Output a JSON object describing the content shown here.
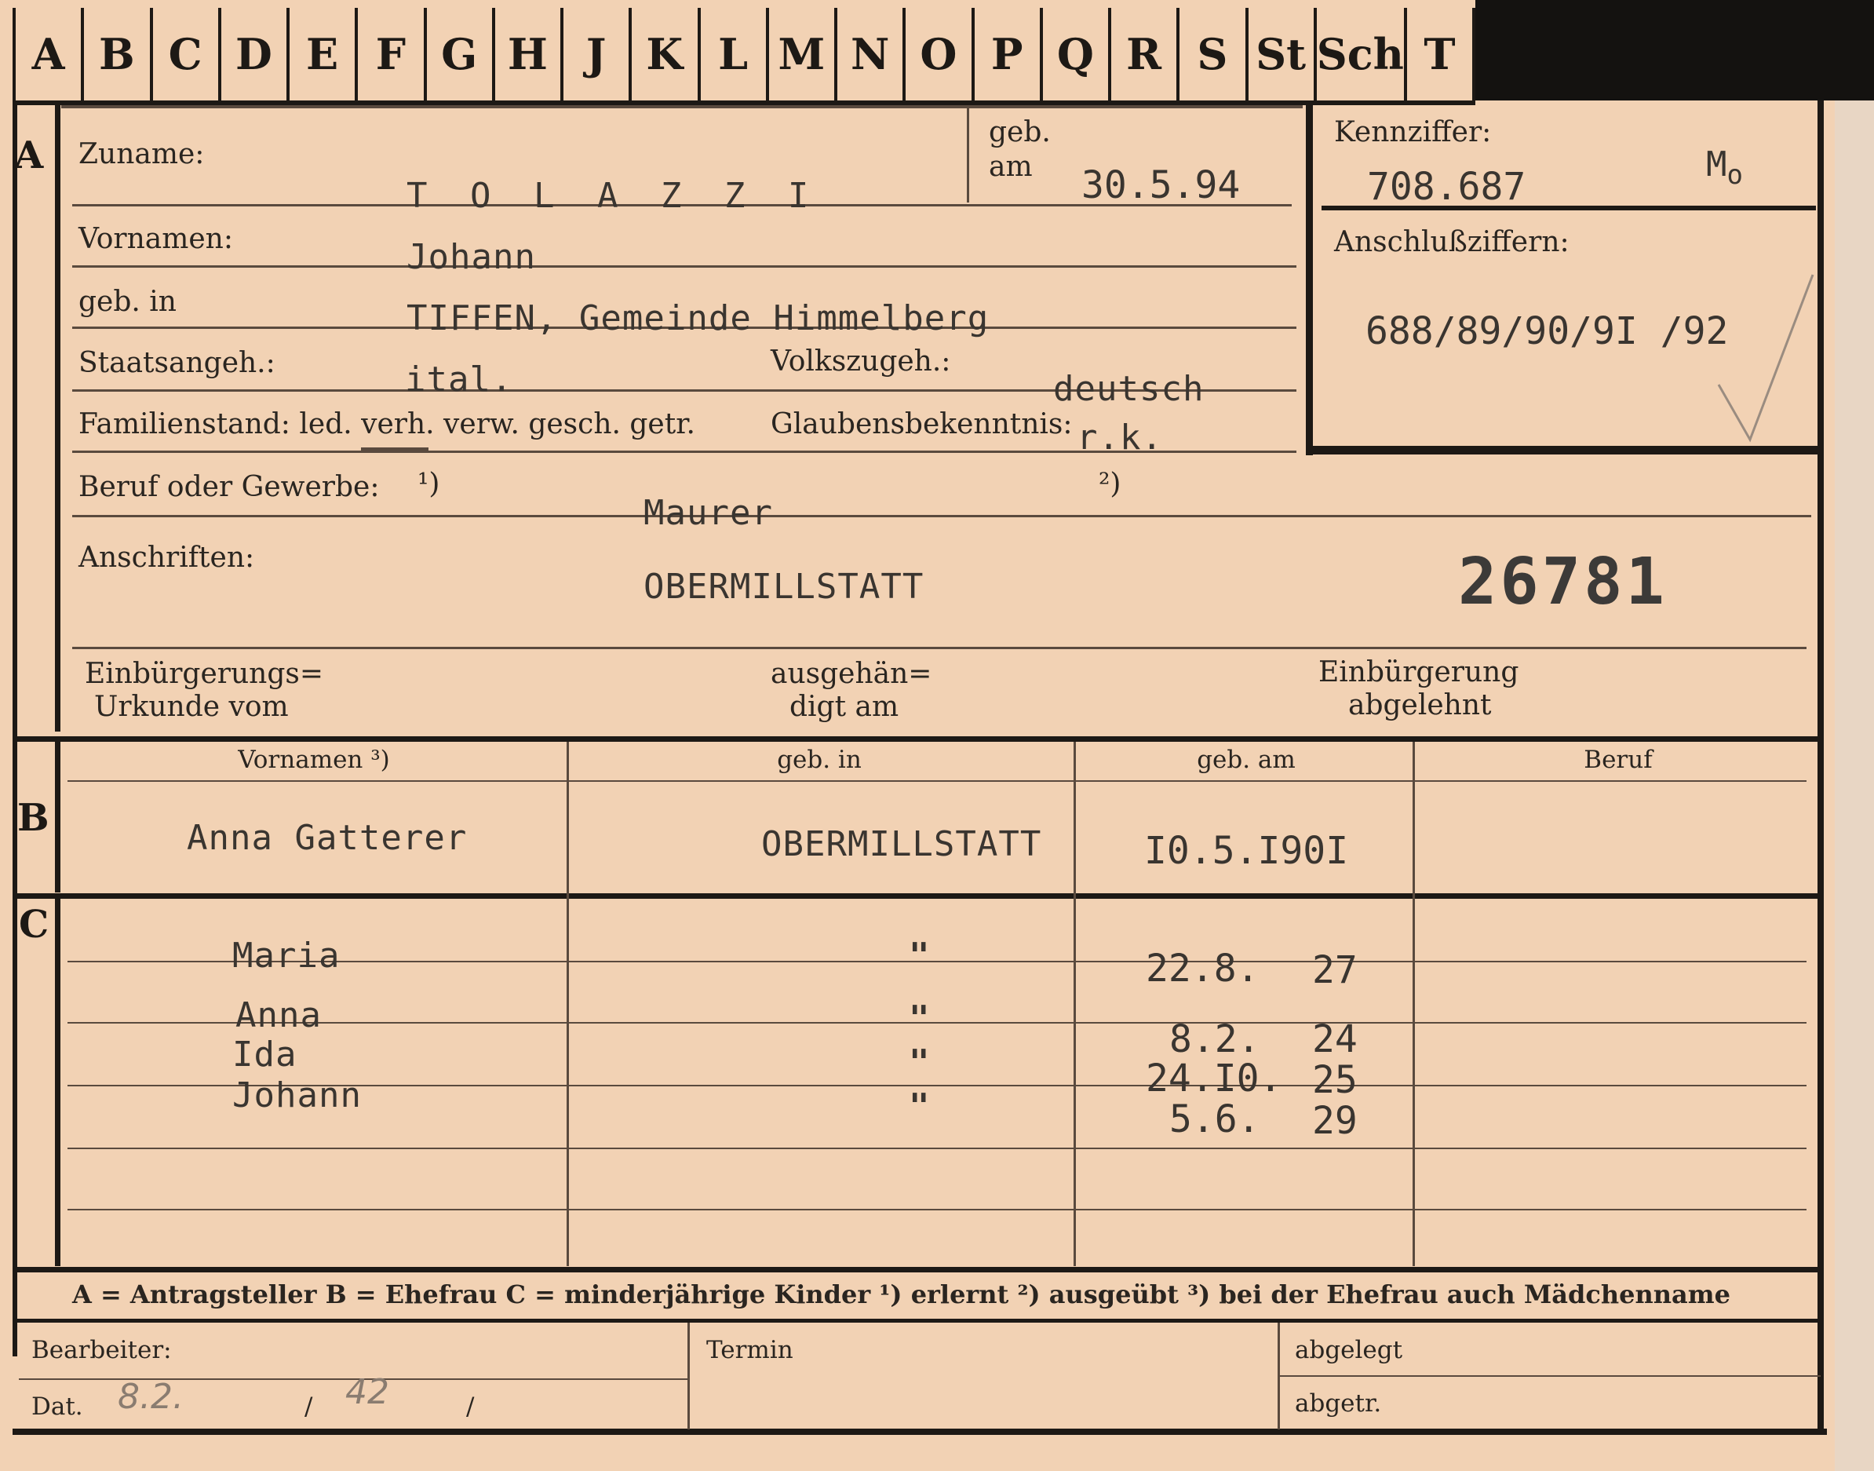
{
  "index_tabs": [
    "A",
    "B",
    "C",
    "D",
    "E",
    "F",
    "G",
    "H",
    "J",
    "K",
    "L",
    "M",
    "N",
    "O",
    "P",
    "Q",
    "R",
    "S",
    "St",
    "Sch",
    "T"
  ],
  "section_letters": {
    "a": "A",
    "b": "B",
    "c": "C"
  },
  "labels": {
    "zuname": "Zuname:",
    "geb_am_1": "geb.",
    "geb_am_2": "am",
    "kennziffer": "Kennziffer:",
    "anschlussziffern": "Anschlußziffern:",
    "vornamen": "Vornamen:",
    "geb_in": "geb. in",
    "staatsangeh": "Staatsangeh.:",
    "volkszugeh": "Volkszugeh.:",
    "familienstand": "Familienstand: led. verh. verw. gesch. getr.",
    "glaubensbekenntnis": "Glaubensbekenntnis:",
    "beruf": "Beruf oder Gewerbe:",
    "beruf_fn1": "¹)",
    "beruf_fn2": "²)",
    "anschriften": "Anschriften:",
    "einbuergerungs_1": "Einbürgerungs=",
    "einbuergerungs_2": "Urkunde vom",
    "ausgehaen_1": "ausgehän=",
    "ausgehaen_2": "digt am",
    "einbuergerung_1": "Einbürgerung",
    "einbuergerung_2": "abgelehnt",
    "col_vornamen": "Vornamen ³)",
    "col_geb_in": "geb. in",
    "col_geb_am": "geb. am",
    "col_beruf": "Beruf",
    "legend": "A = Antragsteller   B = Ehefrau   C = minderjährige Kinder   ¹) erlernt   ²) ausgeübt   ³) bei der Ehefrau auch Mädchenname",
    "bearbeiter": "Bearbeiter:",
    "termin": "Termin",
    "abgelegt": "abgelegt",
    "dat": "Dat.",
    "dat_slash1": "/",
    "dat_slash2": "/",
    "abgetr": "abgetr."
  },
  "applicant": {
    "surname": "T O L A Z Z I",
    "birth_date": "30.5.94",
    "kennziffer": "708.687",
    "kennziffer_mark": "M",
    "kennziffer_sub": "o",
    "anschluss": "688/89/90/9I /92",
    "first_name": "Johann",
    "birthplace": "TIFFEN, Gemeinde Himmelberg",
    "citizenship": "ital.",
    "ethnicity": "deutsch",
    "religion": "r.k.",
    "occupation": "Maurer",
    "address": "OBERMILLSTATT",
    "stamp_number": "26781"
  },
  "wife": {
    "name": "Anna Gatterer",
    "birthplace": "OBERMILLSTATT",
    "birth_date": "I0.5.I90I"
  },
  "children": [
    {
      "name": "Maria",
      "birthplace": "\"",
      "day_month": "22.8.",
      "year": "27"
    },
    {
      "name": "Anna",
      "birthplace": "\"",
      "day_month": "8.2.",
      "year": "24"
    },
    {
      "name": "Ida",
      "birthplace": "\"",
      "day_month": "24.I0.",
      "year": "25"
    },
    {
      "name": "Johann",
      "birthplace": "\"",
      "day_month": "5.6.",
      "year": "29"
    }
  ],
  "handwritten": {
    "dat_day": "8.2.",
    "dat_year": "42"
  },
  "colors": {
    "card": "#f2d2b4",
    "ink": "#1d1915",
    "typewriter": "#3a3530",
    "pencil": "#8a7c70"
  }
}
